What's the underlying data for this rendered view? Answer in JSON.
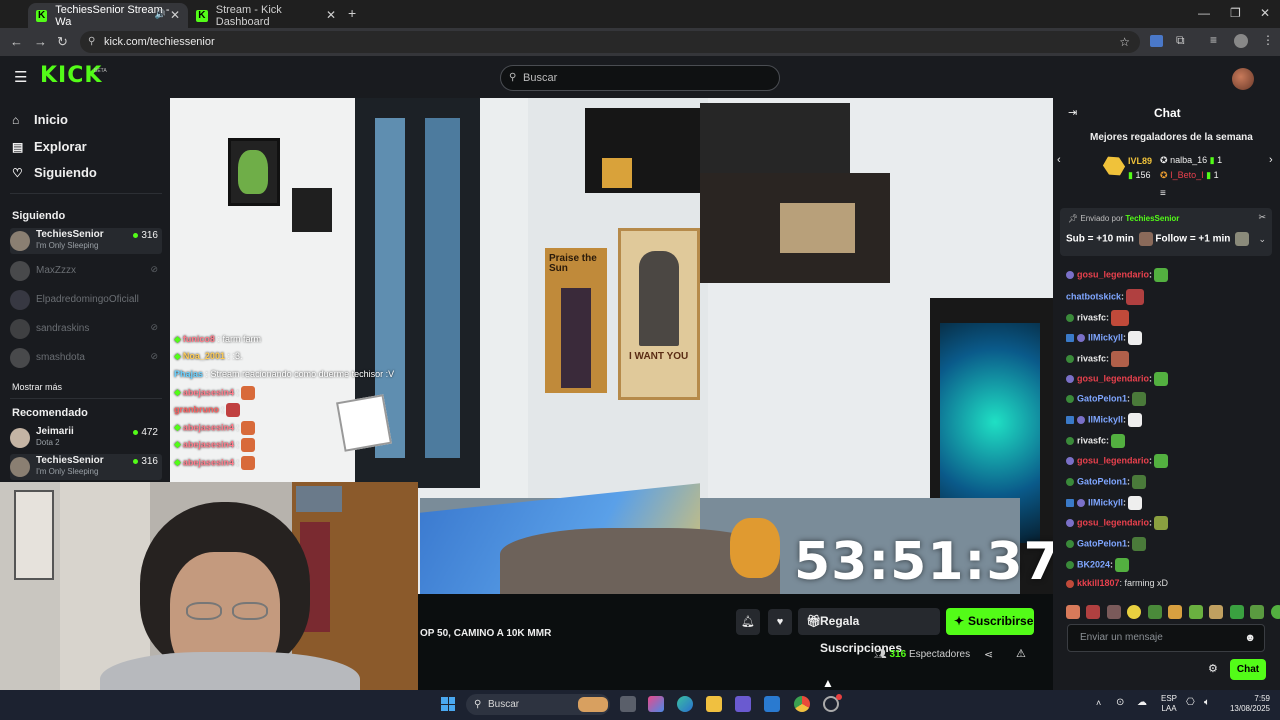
{
  "browser": {
    "tabs": [
      {
        "label": "TechiesSenior Stream - Wa",
        "active": true
      },
      {
        "label": "Stream - Kick Dashboard",
        "active": false
      }
    ],
    "url": "kick.com/techiessenior"
  },
  "header": {
    "logo": "KICK",
    "logo_tag": "BETA",
    "search_placeholder": "Buscar"
  },
  "sidebar": {
    "nav": [
      {
        "label": "Inicio",
        "icon": "home-icon"
      },
      {
        "label": "Explorar",
        "icon": "explore-icon"
      },
      {
        "label": "Siguiendo",
        "icon": "heart-icon"
      }
    ],
    "following_title": "Siguiendo",
    "following": [
      {
        "name": "TechiesSenior",
        "subtitle": "I'm Only Sleeping",
        "viewers": "316",
        "live": true
      },
      {
        "name": "MaxZzzx",
        "live": false
      },
      {
        "name": "ElpadredomingoOficiall",
        "live": false
      },
      {
        "name": "sandraskins",
        "live": false
      },
      {
        "name": "smashdota",
        "live": false
      }
    ],
    "show_more": "Mostrar más",
    "recommended_title": "Recomendado",
    "recommended": [
      {
        "name": "Jeimarii",
        "subtitle": "Dota 2",
        "viewers": "472"
      },
      {
        "name": "TechiesSenior",
        "subtitle": "I'm Only Sleeping",
        "viewers": "316"
      }
    ]
  },
  "video": {
    "timer": "53:51:37",
    "overlay_chat": [
      {
        "user": "funico8",
        "text": ": farm farm"
      },
      {
        "user": "Noa_2001",
        "text": ": :3."
      },
      {
        "user": "Phajas",
        "text": ": Stream reacionando como duerme techisor :V"
      },
      {
        "user": "abejasesin4",
        "text": ":"
      },
      {
        "user": "granbruno",
        "text": ":"
      },
      {
        "user": "abejasesin4",
        "text": ":"
      },
      {
        "user": "abejasesin4",
        "text": ":"
      },
      {
        "user": "abejasesin4",
        "text": ":"
      }
    ],
    "poster_text": "I WANT YOU",
    "poster2_text": "Praise the Sun"
  },
  "stream_info": {
    "title": "OP 50, CAMINO A 10K MMR",
    "gift_label": "Regala Suscripciones",
    "subscribe_label": "Suscribirse",
    "viewers_count": "316",
    "viewers_label": "Espectadores"
  },
  "chat": {
    "title": "Chat",
    "top_gifters_title": "Mejores regaladores de la semana",
    "top_gifters": [
      {
        "level": "IVL89",
        "count": "156"
      },
      {
        "name": "nalba_16",
        "count": "1"
      },
      {
        "name": "I_Beto_I",
        "count": "1"
      }
    ],
    "pinned": {
      "sent_by": "Enviado por",
      "user": "TechiesSenior",
      "sub_text": "Sub = +10 min",
      "follow_text": "Follow = +1 min"
    },
    "messages": [
      {
        "user": "gosu_legendario",
        "color": "#e8414d",
        "text": ":"
      },
      {
        "user": "chatbotskick",
        "color": "#7fa6ff",
        "text": ":"
      },
      {
        "user": "rivasfc",
        "color": "#e8e8e8",
        "text": ":"
      },
      {
        "user": "IlMickyll",
        "color": "#7fa6ff",
        "text": ":"
      },
      {
        "user": "rivasfc",
        "color": "#e8e8e8",
        "text": ":"
      },
      {
        "user": "gosu_legendario",
        "color": "#e8414d",
        "text": ":"
      },
      {
        "user": "GatoPelon1",
        "color": "#7fa6ff",
        "text": ":"
      },
      {
        "user": "IlMickyll",
        "color": "#7fa6ff",
        "text": ":"
      },
      {
        "user": "rivasfc",
        "color": "#e8e8e8",
        "text": ":"
      },
      {
        "user": "gosu_legendario",
        "color": "#e8414d",
        "text": ":"
      },
      {
        "user": "GatoPelon1",
        "color": "#7fa6ff",
        "text": ":"
      },
      {
        "user": "IlMickyll",
        "color": "#7fa6ff",
        "text": ":"
      },
      {
        "user": "gosu_legendario",
        "color": "#e8414d",
        "text": ":"
      },
      {
        "user": "GatoPelon1",
        "color": "#7fa6ff",
        "text": ":"
      },
      {
        "user": "BK2024",
        "color": "#7fa6ff",
        "text": ":"
      },
      {
        "user": "kkkill1807",
        "color": "#e8414d",
        "text": ": farming xD"
      }
    ],
    "input_placeholder": "Enviar un mensaje",
    "send_label": "Chat"
  },
  "taskbar": {
    "search": "Buscar",
    "lang_line1": "ESP",
    "lang_line2": "LAA",
    "time": "7:59",
    "date": "13/08/2025"
  },
  "colors": {
    "brand": "#53fc18",
    "panel": "#191b1f",
    "background": "#0b0e0f"
  }
}
